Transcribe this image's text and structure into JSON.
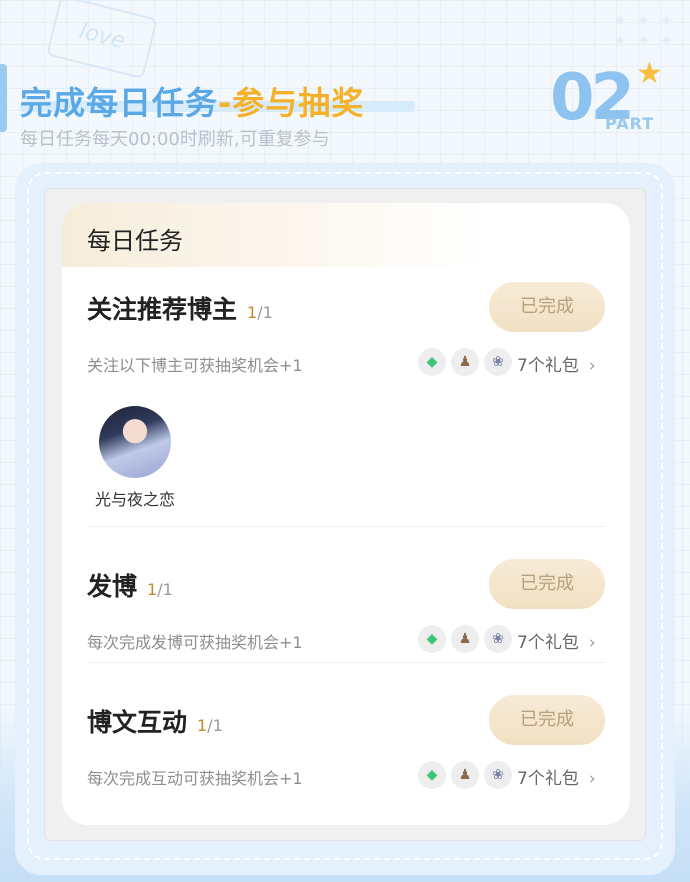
{
  "header": {
    "title_part1": "完成每日任务",
    "title_part2": "-参与抽奖",
    "subtitle": "每日任务每天00:00时刷新,可重复参与",
    "badge_number": "02",
    "badge_label": "PART",
    "decor_tag": "love"
  },
  "card": {
    "title": "每日任务"
  },
  "tasks": [
    {
      "name": "关注推荐博主",
      "progress_done": "1",
      "progress_total": "/1",
      "button_label": "已完成",
      "description": "关注以下博主可获抽奖机会+1",
      "rewards_label": "7个礼包",
      "reward_icons": [
        "diamond-icon",
        "figure-icon",
        "badge-icon"
      ]
    },
    {
      "name": "发博",
      "progress_done": "1",
      "progress_total": "/1",
      "button_label": "已完成",
      "description": "每次完成发博可获抽奖机会+1",
      "rewards_label": "7个礼包",
      "reward_icons": [
        "diamond-icon",
        "figure-icon",
        "badge-icon"
      ]
    },
    {
      "name": "博文互动",
      "progress_done": "1",
      "progress_total": "/1",
      "button_label": "已完成",
      "description": "每次完成互动可获抽奖机会+1",
      "rewards_label": "7个礼包",
      "reward_icons": [
        "diamond-icon",
        "figure-icon",
        "badge-icon"
      ]
    }
  ],
  "blogger": {
    "name": "光与夜之恋"
  },
  "colors": {
    "title_blue": "#5aa9e6",
    "title_gold": "#f5b12a",
    "progress_gold": "#c28a2c",
    "button_bg": "#f4e6cd",
    "button_text": "#b9a07a"
  }
}
